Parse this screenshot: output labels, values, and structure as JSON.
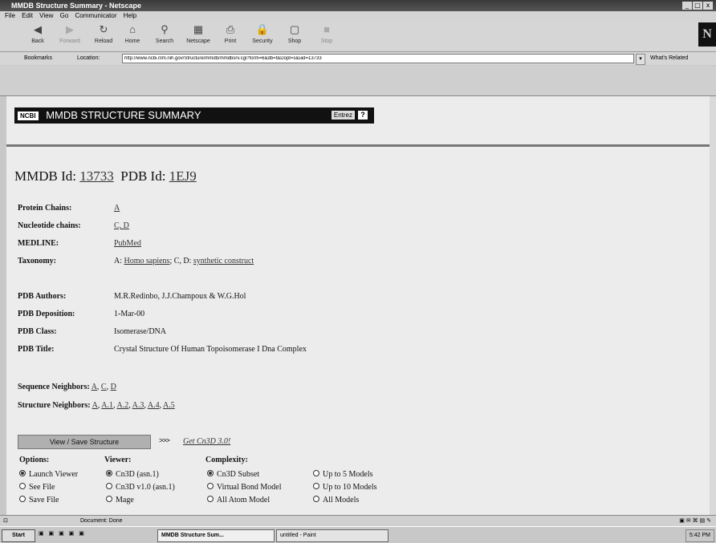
{
  "window": {
    "title": "MMDB Structure Summary - Netscape",
    "controls": [
      "_",
      "□",
      "x"
    ]
  },
  "menu": [
    "File",
    "Edit",
    "View",
    "Go",
    "Communicator",
    "Help"
  ],
  "toolbar": {
    "buttons": [
      {
        "label": "Back",
        "icon": "back-arrow-icon",
        "glyph": "◀"
      },
      {
        "label": "Forward",
        "icon": "forward-arrow-icon",
        "glyph": "▶"
      },
      {
        "label": "Reload",
        "icon": "reload-icon",
        "glyph": "↻"
      },
      {
        "label": "Home",
        "icon": "home-icon",
        "glyph": "⌂"
      },
      {
        "label": "Search",
        "icon": "search-icon",
        "glyph": "⚲"
      },
      {
        "label": "Netscape",
        "icon": "netscape-icon",
        "glyph": "▦"
      },
      {
        "label": "Print",
        "icon": "print-icon",
        "glyph": "⎙"
      },
      {
        "label": "Security",
        "icon": "lock-icon",
        "glyph": "🔒"
      },
      {
        "label": "Shop",
        "icon": "shop-icon",
        "glyph": "▢"
      },
      {
        "label": "Stop",
        "icon": "stop-icon",
        "glyph": "■"
      }
    ],
    "logo": "N"
  },
  "location": {
    "bookmarks_label": "Bookmarks",
    "location_label": "Location:",
    "url": "http://www.ncbi.nlm.nih.gov/Structure/mmdb/mmdbsrv.cgi?form=6&db=t&Dopt=s&uid=13733",
    "whats_related": "What's Related"
  },
  "banner": {
    "ncbi": "NCBI",
    "title": "MMDB   STRUCTURE SUMMARY",
    "entrez": "Entrez",
    "help": "?"
  },
  "ids": {
    "mmdb_label": "MMDB Id:",
    "mmdb_id": "13733",
    "pdb_label": "PDB Id:",
    "pdb_id": "1EJ9"
  },
  "info": {
    "protein_chains_label": "Protein Chains:",
    "protein_chains": "A",
    "nucleotide_chains_label": "Nucleotide chains:",
    "nucleotide_chains": "C, D",
    "medline_label": "MEDLINE:",
    "medline": "PubMed",
    "taxonomy_label": "Taxonomy:",
    "taxonomy_prefix": "A:",
    "taxonomy_link1": "Homo sapiens",
    "taxonomy_mid": "; C, D:",
    "taxonomy_link2": "synthetic construct",
    "authors_label": "PDB Authors:",
    "authors": "M.R.Redinbo, J.J.Champoux & W.G.Hol",
    "deposition_label": "PDB Deposition:",
    "deposition": "1-Mar-00",
    "class_label": "PDB Class:",
    "class": "Isomerase/DNA",
    "title_label": "PDB Title:",
    "title": "Crystal Structure Of Human Topoisomerase I Dna Complex"
  },
  "neighbors": {
    "sequence_label": "Sequence Neighbors:",
    "sequence": [
      "A",
      "C",
      "D"
    ],
    "structure_label": "Structure Neighbors:",
    "structure": [
      "A",
      "A.1",
      "A.2",
      "A.3",
      "A.4",
      "A.5"
    ]
  },
  "view": {
    "button": "View / Save Structure",
    "arrows": ">>>",
    "get_cn3d": "Get Cn3D 3.0!"
  },
  "options": {
    "options_header": "Options:",
    "viewer_header": "Viewer:",
    "complexity_header": "Complexity:",
    "options": [
      "Launch Viewer",
      "See File",
      "Save File"
    ],
    "viewer": [
      "Cn3D (asn.1)",
      "Cn3D v1.0 (asn.1)",
      "Mage"
    ],
    "complexity_a": [
      "Cn3D Subset",
      "Virtual Bond Model",
      "All Atom Model"
    ],
    "complexity_b": [
      "Up to 5 Models",
      "Up to 10 Models",
      "All Models"
    ]
  },
  "status": {
    "text": "Document: Done"
  },
  "taskbar": {
    "start": "Start",
    "task1": "MMDB Structure Sum...",
    "task2": "untitled - Paint",
    "clock": "5:42 PM"
  }
}
